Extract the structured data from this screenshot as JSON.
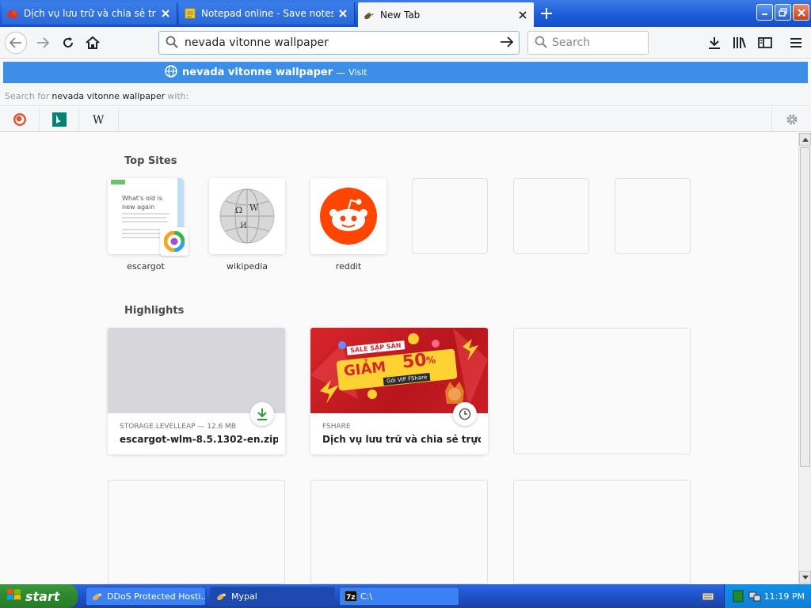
{
  "tabs": [
    {
      "title": "Dịch vụ lưu trữ và chia sẻ trực tuyến",
      "favicon": "cloud-icon",
      "active": false
    },
    {
      "title": "Notepad online - Save notes online",
      "favicon": "notepad-icon",
      "active": false
    },
    {
      "title": "New Tab",
      "favicon": "mypal-icon",
      "active": true
    }
  ],
  "navbar": {
    "url_value": "nevada vitonne wallpaper",
    "search_placeholder": "Search"
  },
  "suggestion": {
    "query": "nevada vitonne wallpaper",
    "dash": "—",
    "action": "Visit"
  },
  "search_for": {
    "prefix": "Search for",
    "query": "nevada vitonne wallpaper",
    "suffix": "with:"
  },
  "engines": [
    "duckduckgo-icon",
    "bing-icon",
    "wikipedia-icon"
  ],
  "top_sites": {
    "title": "Top Sites",
    "items": [
      {
        "label": "escargot",
        "preview_heading": "What's old is new again"
      },
      {
        "label": "wikipedia",
        "preview_heading": ""
      },
      {
        "label": "reddit",
        "preview_heading": ""
      }
    ]
  },
  "highlights": {
    "title": "Highlights",
    "items": [
      {
        "host": "STORAGE.LEVELLEAP — 12.6 MB",
        "title": "escargot-wlm-8.5.1302-en.zip",
        "badge": "download-icon"
      },
      {
        "host": "FSHARE",
        "title": "Dịch vụ lưu trữ và chia sẻ trực t...",
        "badge": "clock-icon",
        "image_text": {
          "sale": "SALE SẬP SÀN",
          "giam": "GIẢM",
          "percent": "50",
          "pct_sign": "%",
          "vip": "Gói VIP FShare"
        }
      }
    ]
  },
  "taskbar": {
    "start_label": "start",
    "items": [
      {
        "label": "DDoS Protected Hosti...",
        "icon": "mypal-icon",
        "active": false
      },
      {
        "label": "Mypal",
        "icon": "mypal-icon",
        "active": true
      },
      {
        "label": "C:\\",
        "icon": "7zip-icon",
        "active": false
      }
    ],
    "clock": "11:19 PM"
  },
  "colors": {
    "accent": "#3c8ee6",
    "title_bar": "#1c5ad8",
    "taskbar": "#245edb",
    "start_green": "#2f8a2f"
  }
}
